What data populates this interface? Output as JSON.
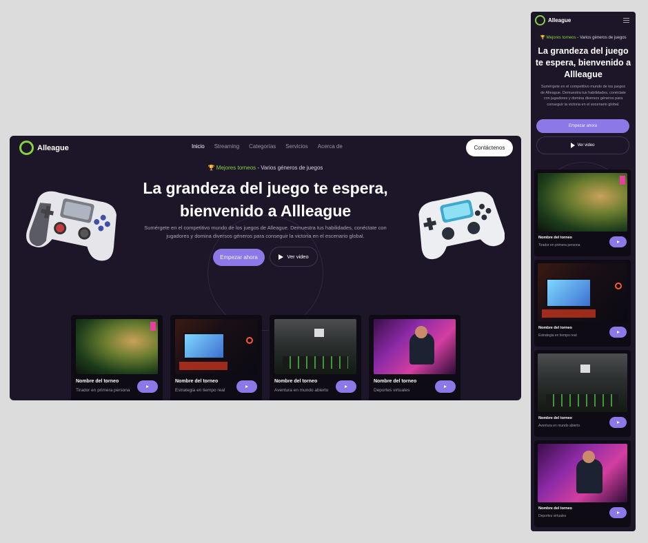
{
  "brand": {
    "name": "Alleague",
    "accent": "#86d33f",
    "purple": "#8d78e8",
    "background": "#1d1628"
  },
  "nav": {
    "items": [
      "Inicio",
      "Streaming",
      "Categorías",
      "Servicios",
      "Acerca de"
    ],
    "contact_label": "Contáctenos"
  },
  "hero": {
    "tag_icon": "trophy-icon",
    "tag_highlight": "Mejores torneos",
    "tag_rest": " - Varios géneros de juegos",
    "title": "La grandeza del juego te espera, bienvenido a Allleague",
    "description": "Sumérgete en el competitivo mundo de los juegos de Alleague. Demuestra tus habilidades, conéctate con jugadores y domina diversos géneros para conseguir la victoria en el escenario global.",
    "cta_primary": "Empezar ahora",
    "cta_secondary": "Ver video"
  },
  "cards": [
    {
      "title": "Nombre del torneo",
      "subtitle": "Tirador en primera persona"
    },
    {
      "title": "Nombre del torneo",
      "subtitle": "Estrategia en tiempo real"
    },
    {
      "title": "Nombre del torneo",
      "subtitle": "Aventura en mundo abierto"
    },
    {
      "title": "Nombre del torneo",
      "subtitle": "Deportes virtuales"
    }
  ]
}
